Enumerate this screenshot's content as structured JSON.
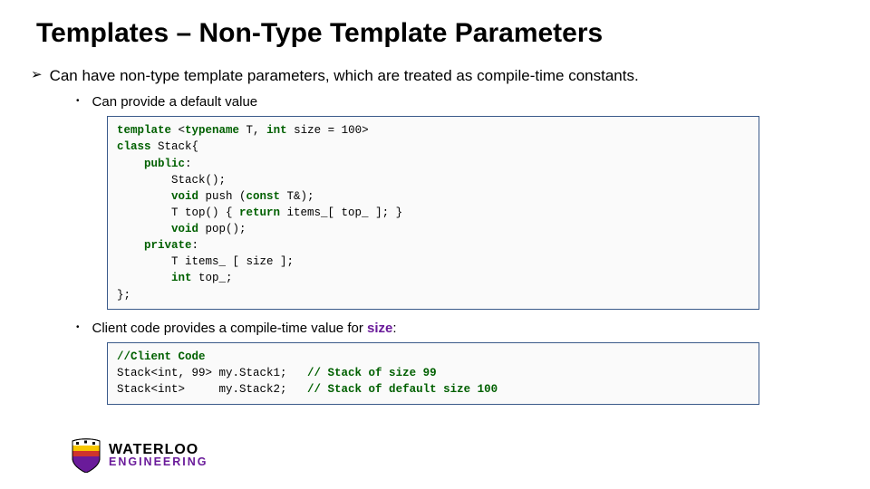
{
  "title": "Templates – Non-Type Template Parameters",
  "bullet1": "Can have non-type template parameters, which are treated as compile-time constants.",
  "sub1": "Can provide a default value",
  "code1": {
    "l1a": "template",
    "l1b": " <",
    "l1c": "typename",
    "l1d": " T, ",
    "l1e": "int",
    "l1f": " size = 100>",
    "l2a": "class",
    "l2b": " Stack{",
    "l3a": "    public",
    "l3b": ":",
    "l4": "        Stack();",
    "l5a": "        void",
    "l5b": " push (",
    "l5c": "const",
    "l5d": " T&);",
    "l6a": "        T top() { ",
    "l6b": "return",
    "l6c": " items_[ top_ ]; }",
    "l7a": "        void",
    "l7b": " pop();",
    "l8a": "    private",
    "l8b": ":",
    "l9": "        T items_ [ size ];",
    "l10a": "        int",
    "l10b": " top_;",
    "l11": "};"
  },
  "sub2a": "Client code provides a compile-time value for ",
  "sub2b": "size",
  "sub2c": ":",
  "code2": {
    "l1": "//Client Code",
    "l2a": "Stack<int, 99> my.Stack1;   ",
    "l2b": "// Stack of size 99",
    "l3a": "Stack<int>     my.Stack2;   ",
    "l3b": "// Stack of default size 100"
  },
  "logo": {
    "wat": "WATERLOO",
    "eng": "ENGINEERING"
  }
}
